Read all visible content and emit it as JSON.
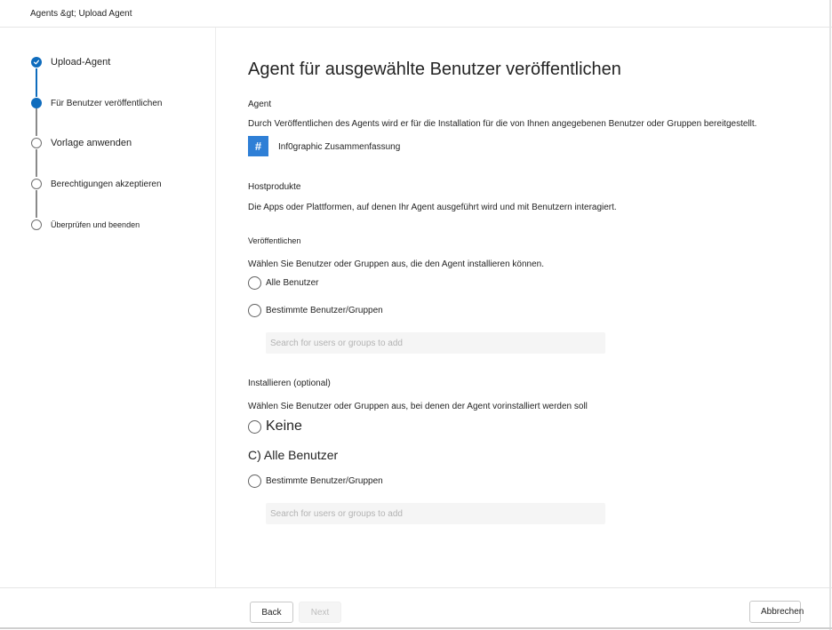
{
  "breadcrumb": "Agents &gt; Upload Agent",
  "steps": [
    {
      "label": "Upload-Agent",
      "state": "done"
    },
    {
      "label": "Für Benutzer veröffentlichen",
      "state": "current"
    },
    {
      "label": "Vorlage anwenden",
      "state": "todo"
    },
    {
      "label": "Berechtigungen akzeptieren",
      "state": "todo"
    },
    {
      "label": "Überprüfen und beenden",
      "state": "todo"
    }
  ],
  "main": {
    "title": "Agent für ausgewählte Benutzer veröffentlichen",
    "agent_section": {
      "heading": "Agent",
      "description": "Durch Veröffentlichen des Agents wird er für die Installation für die von Ihnen angegebenen Benutzer oder Gruppen bereitgestellt.",
      "icon_glyph": "#",
      "icon_color": "#2f7fd6",
      "agent_name": "Inf0graphic Zusammenfassung"
    },
    "host_section": {
      "heading": "Hostprodukte",
      "description": "Die Apps oder Plattformen, auf denen Ihr Agent ausgeführt wird und mit Benutzern interagiert."
    },
    "publish_section": {
      "heading": "Veröffentlichen",
      "description": "Wählen Sie Benutzer oder Gruppen aus, die den Agent installieren können.",
      "option_all": "Alle Benutzer",
      "option_specific": "Bestimmte Benutzer/Gruppen",
      "search_placeholder": "Search for users or groups to add"
    },
    "install_section": {
      "heading": "Installieren (optional)",
      "description": "Wählen Sie Benutzer oder Gruppen aus, bei denen der Agent vorinstalliert werden soll",
      "option_none": "Keine",
      "option_all": "C) Alle Benutzer",
      "option_specific": "Bestimmte Benutzer/Gruppen",
      "search_placeholder": "Search for users or groups to add"
    }
  },
  "footer": {
    "back_label": "Back",
    "next_label": "Next",
    "cancel_label": "Abbrechen"
  },
  "colors": {
    "accent": "#0f6cbd"
  }
}
